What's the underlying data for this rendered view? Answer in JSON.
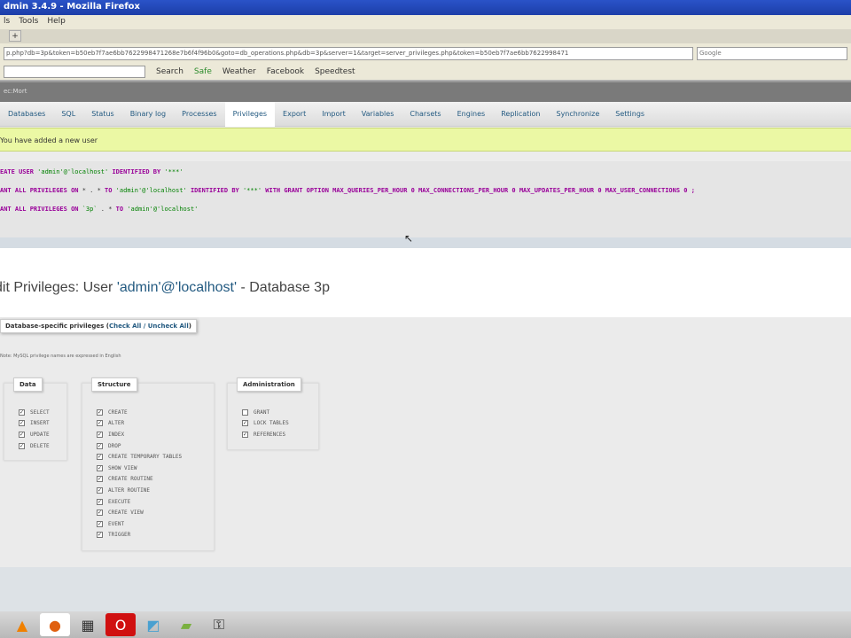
{
  "window": {
    "title": "dmin 3.4.9 - Mozilla Firefox"
  },
  "menu": [
    "ls",
    "Tools",
    "Help"
  ],
  "tab_new": "+",
  "url": "p.php?db=3p&token=b50eb7f7ae6bb7622998471268e7b6f4f96b0&goto=db_operations.php&db=3p&server=1&target=server_privileges.php&token=b50eb7f7ae6bb7622998471",
  "search_placeholder": "Google",
  "toolbar": {
    "search": "Search",
    "safe": "Safe",
    "weather": "Weather",
    "facebook": "Facebook",
    "speedtest": "Speedtest"
  },
  "pma_top": "ec:Mort",
  "tabs": [
    "Databases",
    "SQL",
    "Status",
    "Binary log",
    "Processes",
    "Privileges",
    "Export",
    "Import",
    "Variables",
    "Charsets",
    "Engines",
    "Replication",
    "Synchronize",
    "Settings"
  ],
  "active_tab": "Privileges",
  "notice": "You have added a new user",
  "sql": {
    "l1": {
      "kw1": "EATE USER ",
      "s1": "'admin'@'localhost'",
      "kw2": " IDENTIFIED BY ",
      "s2": "'***'"
    },
    "l2": {
      "kw1": "ANT ALL PRIVILEGES ON ",
      "o1": "* . * ",
      "kw2": "TO ",
      "s1": "'admin'@'localhost'",
      "kw3": " IDENTIFIED BY ",
      "s2": "'***'",
      "kw4": " WITH GRANT OPTION MAX_QUERIES_PER_HOUR 0 MAX_CONNECTIONS_PER_HOUR 0 MAX_UPDATES_PER_HOUR 0 MAX_USER_CONNECTIONS 0 ;"
    },
    "l3": {
      "kw1": "ANT ALL PRIVILEGES ON ",
      "s0": "`3p`",
      "o1": " . * ",
      "kw2": "TO ",
      "s1": "'admin'@'localhost'"
    }
  },
  "heading": {
    "pre": "dit Privileges: User ",
    "user": "'admin'@'localhost'",
    "post": " - Database 3p"
  },
  "legend": {
    "label": "Database-specific privileges (",
    "link": "Check All / Uncheck All",
    "close": ")"
  },
  "note": "Note: MySQL privilege names are expressed in English",
  "groups": [
    {
      "title": "Data",
      "items": [
        {
          "n": "SELECT",
          "c": true
        },
        {
          "n": "INSERT",
          "c": true
        },
        {
          "n": "UPDATE",
          "c": true
        },
        {
          "n": "DELETE",
          "c": true
        }
      ]
    },
    {
      "title": "Structure",
      "items": [
        {
          "n": "CREATE",
          "c": true
        },
        {
          "n": "ALTER",
          "c": true
        },
        {
          "n": "INDEX",
          "c": true
        },
        {
          "n": "DROP",
          "c": true
        },
        {
          "n": "CREATE TEMPORARY TABLES",
          "c": true
        },
        {
          "n": "SHOW VIEW",
          "c": true
        },
        {
          "n": "CREATE ROUTINE",
          "c": true
        },
        {
          "n": "ALTER ROUTINE",
          "c": true
        },
        {
          "n": "EXECUTE",
          "c": true
        },
        {
          "n": "CREATE VIEW",
          "c": true
        },
        {
          "n": "EVENT",
          "c": true
        },
        {
          "n": "TRIGGER",
          "c": true
        }
      ]
    },
    {
      "title": "Administration",
      "items": [
        {
          "n": "GRANT",
          "c": false
        },
        {
          "n": "LOCK TABLES",
          "c": true
        },
        {
          "n": "REFERENCES",
          "c": true
        }
      ]
    }
  ],
  "taskbar": [
    "vlc-icon",
    "firefox-icon",
    "media-icon",
    "opera-icon",
    "app-icon",
    "notes-icon",
    "usb-icon"
  ]
}
